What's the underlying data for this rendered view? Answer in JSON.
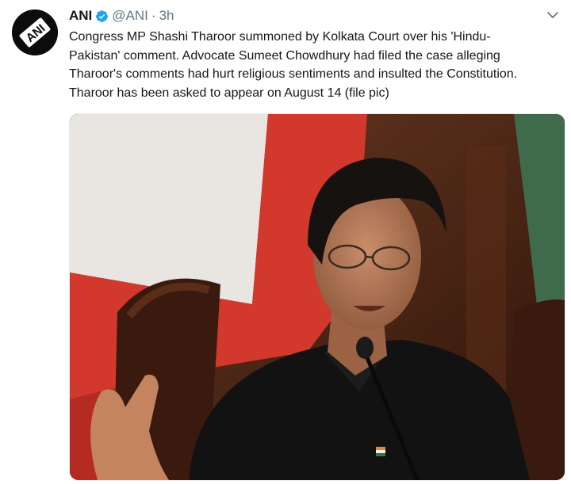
{
  "tweet": {
    "author_name": "ANI",
    "author_handle": "@ANI",
    "separator": "·",
    "time": "3h",
    "text_lines": [
      "Congress MP Shashi Tharoor summoned by Kolkata Court over his 'Hindu-",
      "Pakistan' comment. Advocate Sumeet Chowdhury had filed the case alleging",
      "Tharoor's comments had hurt religious sentiments and insulted the Constitution.",
      "Tharoor has been asked to appear on August 14 (file pic)"
    ],
    "avatar_logo_text": "ANI",
    "photo_description_icon": "news-photo"
  },
  "icons": {
    "verified": "verified-badge-icon",
    "menu": "chevron-down-icon"
  },
  "colors": {
    "verified_blue": "#1da1f2",
    "secondary_text": "#657786",
    "primary_text": "#14171a"
  }
}
